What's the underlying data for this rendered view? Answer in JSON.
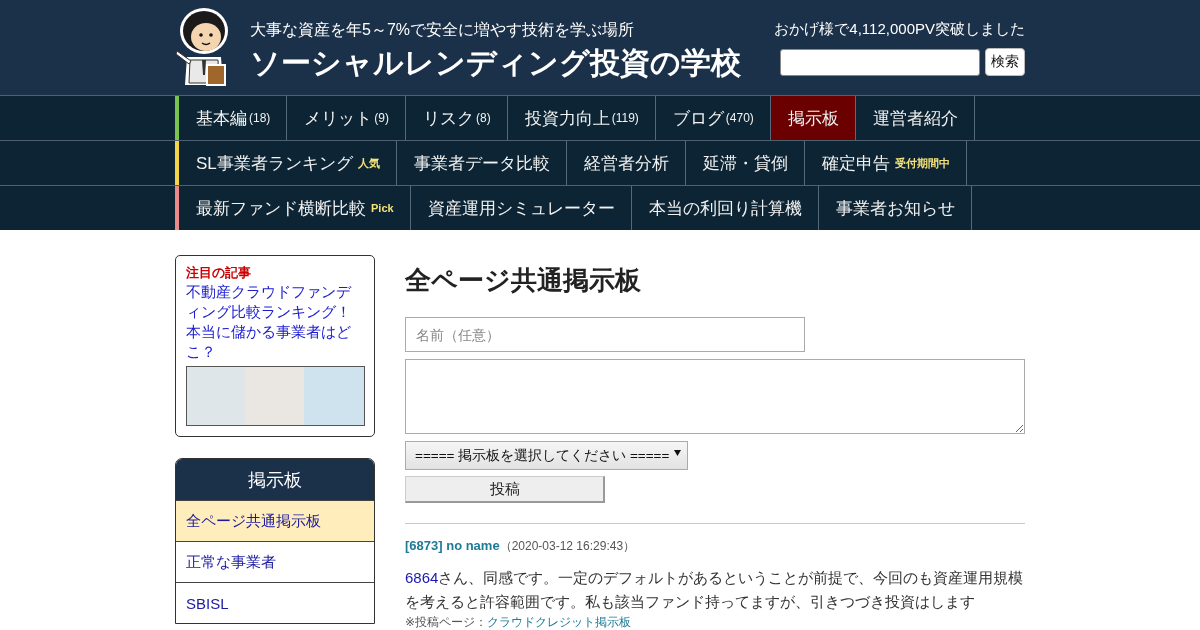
{
  "header": {
    "tagline": "大事な資産を年5～7%で安全に増やす技術を学ぶ場所",
    "title": "ソーシャルレンディング投資の学校",
    "pv_notice": "おかげ様で4,112,000PV突破しました",
    "search_button": "検索"
  },
  "nav": {
    "rows": [
      {
        "color": "#7cc24e",
        "items": [
          {
            "label": "基本編",
            "count": "(18)",
            "selected": false
          },
          {
            "label": "メリット",
            "count": "(9)",
            "selected": false
          },
          {
            "label": "リスク",
            "count": "(8)",
            "selected": false
          },
          {
            "label": "投資力向上",
            "count": "(119)",
            "selected": false
          },
          {
            "label": "ブログ",
            "count": "(470)",
            "selected": false
          },
          {
            "label": "掲示板",
            "selected": true
          },
          {
            "label": "運営者紹介",
            "selected": false
          }
        ]
      },
      {
        "color": "#f2d54a",
        "items": [
          {
            "label": "SL事業者ランキング",
            "badge": "人気",
            "selected": false
          },
          {
            "label": "事業者データ比較",
            "selected": false
          },
          {
            "label": "経営者分析",
            "selected": false
          },
          {
            "label": "延滞・貸倒",
            "selected": false
          },
          {
            "label": "確定申告",
            "badge": "受付期間中",
            "selected": false
          }
        ]
      },
      {
        "color": "#ec8a8a",
        "items": [
          {
            "label": "最新ファンド横断比較",
            "badge": "Pick",
            "selected": false
          },
          {
            "label": "資産運用シミュレーター",
            "selected": false
          },
          {
            "label": "本当の利回り計算機",
            "selected": false
          },
          {
            "label": "事業者お知らせ",
            "selected": false
          }
        ]
      }
    ]
  },
  "sidebar": {
    "featured": {
      "label": "注目の記事",
      "title": "不動産クラウドファンディング比較ランキング！本当に儲かる事業者はどこ？"
    },
    "board_menu": {
      "title": "掲示板",
      "items": [
        {
          "label": "全ページ共通掲示板",
          "selected": true
        },
        {
          "label": "正常な事業者",
          "selected": false
        },
        {
          "label": "SBISL",
          "selected": false
        }
      ]
    }
  },
  "main": {
    "page_title": "全ページ共通掲示板",
    "form": {
      "name_placeholder": "名前（任意）",
      "board_select": "===== 掲示板を選択してください =====",
      "submit": "投稿"
    },
    "posts": [
      {
        "heading": "[6873] no name",
        "date": "（2020-03-12 16:29:43）",
        "reply_ref": "6864",
        "body": "さん、同感です。一定のデフォルトがあるということが前提で、今回のも資産運用規模を考えると許容範囲です。私も該当ファンド持ってますが、引きつづき投資はします",
        "source_label": "※投稿ページ：",
        "source_link": "クラウドクレジット掲示板"
      }
    ]
  }
}
